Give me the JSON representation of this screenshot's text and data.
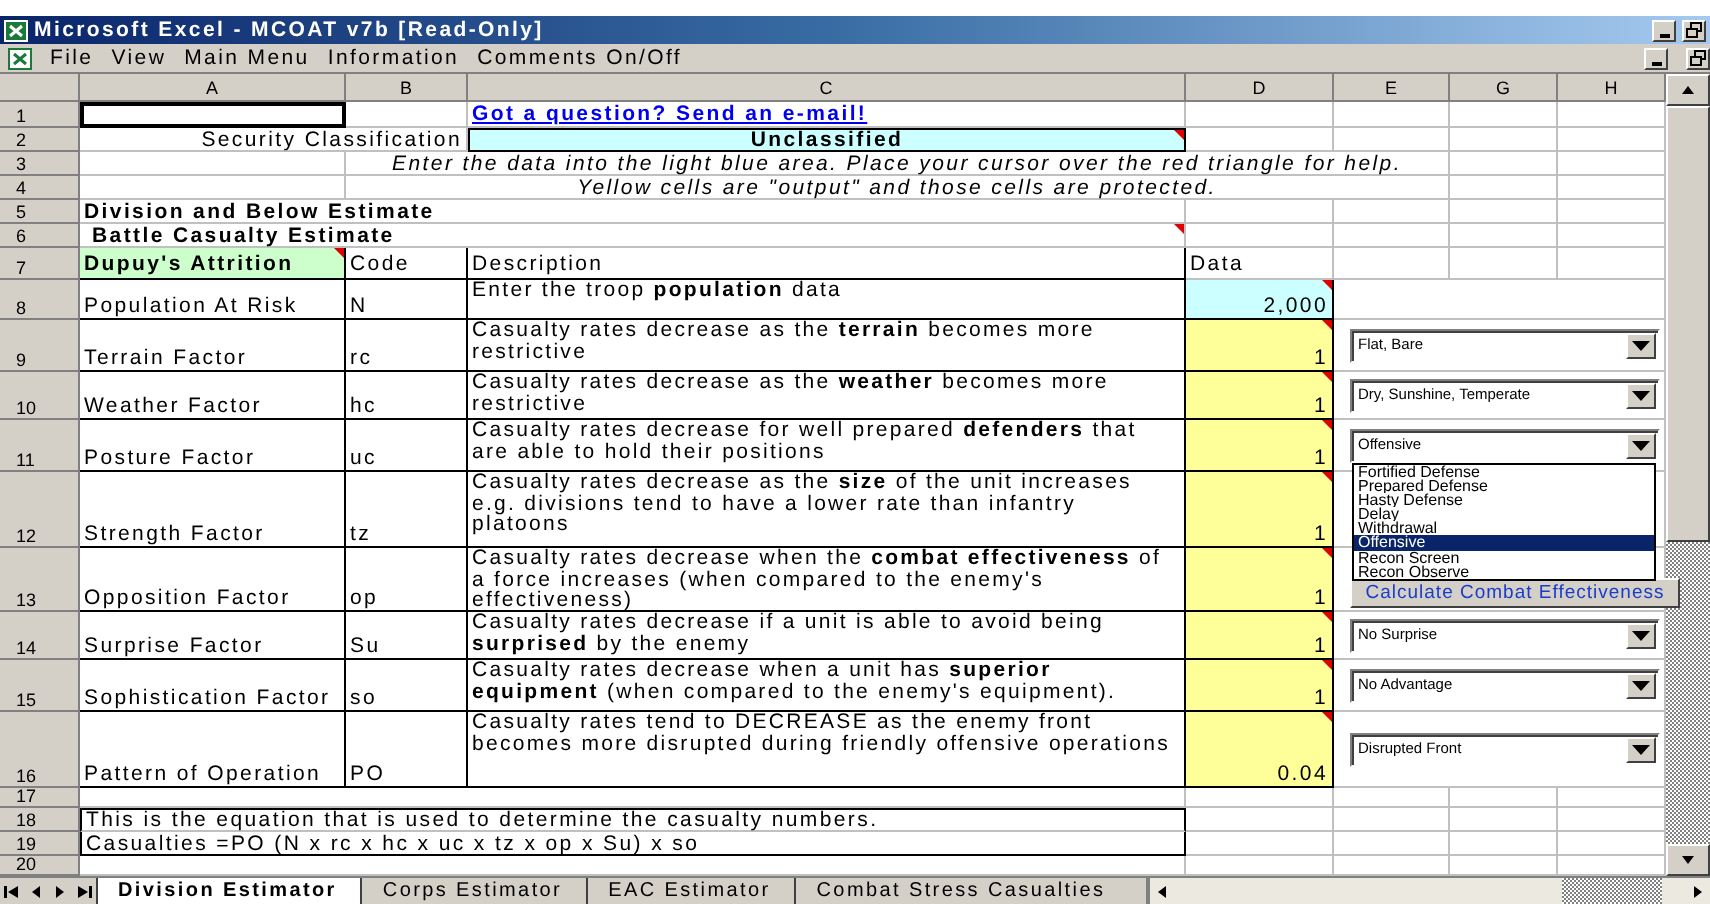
{
  "window": {
    "title": "Microsoft Excel - MCOAT v7b  [Read-Only]"
  },
  "menu": [
    {
      "label": "File",
      "selected": false
    },
    {
      "label": "View",
      "selected": false
    },
    {
      "label": "Main Menu",
      "selected": false
    },
    {
      "label": "Information",
      "selected": false
    },
    {
      "label": "Comments On/Off",
      "selected": false
    }
  ],
  "columns": [
    "A",
    "B",
    "C",
    "D",
    "E",
    "G",
    "H"
  ],
  "row_numbers": [
    "1",
    "2",
    "3",
    "4",
    "5",
    "6",
    "7",
    "8",
    "9",
    "10",
    "11",
    "12",
    "13",
    "14",
    "15",
    "16",
    "17",
    "18",
    "19",
    "20"
  ],
  "link": "Got a question? Send an e-mail!",
  "security": {
    "label": "Security Classification",
    "value": "Unclassified",
    "comment": true
  },
  "instructions": [
    "Enter the data into the light blue area. Place your cursor over the red triangle for help.",
    "Yellow cells are \"output\" and those cells are protected."
  ],
  "headings": [
    {
      "text": "Division and Below  Estimate",
      "comment": false
    },
    {
      "text": "Battle Casualty Estimate",
      "comment": true
    }
  ],
  "table_header": {
    "factor": "Dupuy's Attrition",
    "code": "Code",
    "description": "Description",
    "data": "Data",
    "comment": true
  },
  "factors": [
    {
      "name": "Population At Risk",
      "code": "N",
      "description": "Enter the troop **population** data",
      "data": "2,000",
      "kind": "input",
      "comment": true
    },
    {
      "name": "Terrain Factor",
      "code": "rc",
      "description": "Casualty rates decrease as the **terrain** becomes more restrictive",
      "data": "1",
      "kind": "output",
      "comment": true,
      "selector": {
        "value": "Flat, Bare"
      }
    },
    {
      "name": "Weather Factor",
      "code": "hc",
      "description": "Casualty rates decrease as the **weather** becomes more restrictive",
      "data": "1",
      "kind": "output",
      "comment": true,
      "selector": {
        "value": "Dry, Sunshine, Temperate"
      }
    },
    {
      "name": "Posture Factor",
      "code": "uc",
      "description": "Casualty rates decrease for well prepared **defenders** that are able to hold their positions",
      "data": "1",
      "kind": "output",
      "comment": true,
      "selector": {
        "value": "Offensive",
        "expanded": true,
        "options": [
          {
            "label": "Fortified Defense",
            "selected": false
          },
          {
            "label": "Prepared Defense",
            "selected": false
          },
          {
            "label": "Hasty Defense",
            "selected": false
          },
          {
            "label": "Delay",
            "selected": false
          },
          {
            "label": "Withdrawal",
            "selected": false
          },
          {
            "label": "Offensive",
            "selected": true
          },
          {
            "label": "Recon Screen",
            "selected": false
          },
          {
            "label": "Recon Observe",
            "selected": false
          }
        ]
      }
    },
    {
      "name": "Strength Factor",
      "code": "tz",
      "description": "Casualty rates decrease as the **size** of the unit increases e.g. divisions tend to have a lower rate than infantry platoons",
      "data": "1",
      "kind": "output",
      "comment": true
    },
    {
      "name": "Opposition Factor",
      "code": "op",
      "description": "Casualty rates decrease when the **combat effectiveness** of a force increases (when compared to the enemy's effectiveness)",
      "data": "1",
      "kind": "output",
      "comment": true,
      "action": "Calculate Combat Effectiveness"
    },
    {
      "name": "Surprise Factor",
      "code": "Su",
      "description": "Casualty rates decrease if a unit is able to avoid being **surprised** by the enemy",
      "data": "1",
      "kind": "output",
      "comment": true,
      "selector": {
        "value": "No Surprise"
      }
    },
    {
      "name": "Sophistication Factor",
      "code": "so",
      "description": "Casualty rates decrease when a unit has **superior equipment** (when compared to the enemy's equipment).",
      "data": "1",
      "kind": "output",
      "comment": true,
      "selector": {
        "value": "No Advantage"
      }
    },
    {
      "name": "Pattern of Operation",
      "code": "PO",
      "description": "Casualty rates tend to DECREASE as the enemy front becomes more disrupted during friendly offensive operations",
      "data": "0.04",
      "kind": "output",
      "comment": true,
      "selector": {
        "value": "Disrupted Front"
      }
    }
  ],
  "notes": [
    "This is the equation that is used to determine the casualty numbers.",
    "Casualties =PO (N x rc x hc x uc x tz x op x Su) x so"
  ],
  "sheet_tabs": [
    {
      "label": "Division Estimator",
      "selected": true
    },
    {
      "label": "Corps Estimator",
      "selected": false
    },
    {
      "label": "EAC Estimator",
      "selected": false
    },
    {
      "label": "Combat Stress Casualties",
      "selected": false
    }
  ]
}
